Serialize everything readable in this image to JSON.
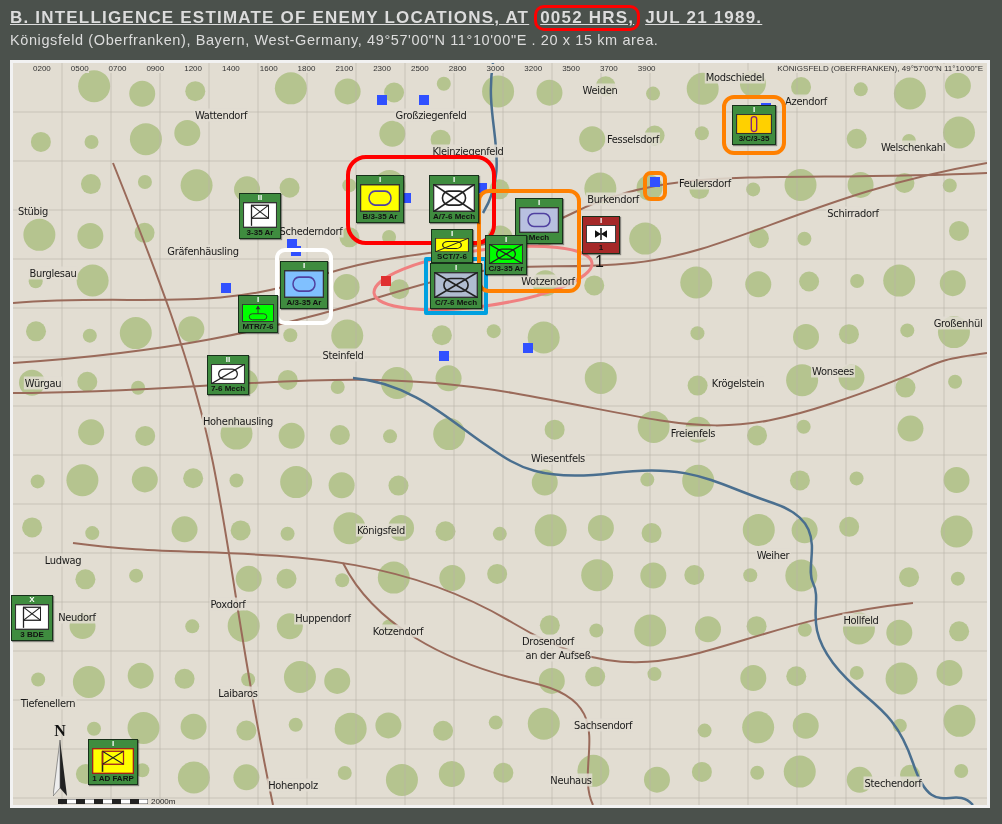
{
  "header": {
    "title_before": "B. INTELLIGENCE ESTIMATE OF ENEMY LOCATIONS, AT",
    "title_highlight": "0052 HRS,",
    "title_after": "JUL 21 1989.",
    "subtitle": "Königsfeld (Oberfranken), Bayern, West-Germany, 49°57'00\"N 11°10'00\"E . 20 x 15 km area."
  },
  "map": {
    "grid_labels": [
      "0200",
      "0500",
      "0700",
      "0900",
      "1200",
      "1400",
      "1600",
      "1800",
      "2100",
      "2300",
      "2500",
      "2800",
      "3000",
      "3200",
      "3500",
      "3700",
      "3900"
    ],
    "sheet_label": "KÖNIGSFELD (OBERFRANKEN), 49°57'00\"N 11°10'00\"E",
    "towns": [
      "Wattendorf",
      "Großziegenfeld",
      "Kleinziegenfeld",
      "Weiden",
      "Modschiedel",
      "Azendorf",
      "Welschenkahl",
      "Fesselsdorf",
      "Feulersdorf",
      "Burkendorf",
      "Stübig",
      "Schederndorf",
      "Gräfenhäusling",
      "Wotzendorf",
      "Schirradorf",
      "Burglesau",
      "Großenhül",
      "Würgau",
      "Steinfeld",
      "Krögelstein",
      "Wonsees",
      "Hohenhausling",
      "Freienfels",
      "Wiesentfels",
      "Ludwag",
      "Königsfeld",
      "Weiher",
      "Neudorf",
      "Poxdorf",
      "Huppendorf",
      "Kotzendorf",
      "Hollfeld",
      "Drosendorf",
      "an der Aufseß",
      "Tiefenellern",
      "Laibaros",
      "Sachsendorf",
      "Hohenpolz",
      "Neuhaus",
      "Stechendorf"
    ],
    "units": [
      {
        "label": "3-35 Ar",
        "echelon": "II",
        "hostile": false,
        "kind": "hq",
        "color": "#ffffff"
      },
      {
        "label": "B/3-35 Ar",
        "echelon": "I",
        "hostile": false,
        "kind": "armor",
        "color": "#ffff00"
      },
      {
        "label": "A/7-6 Mech",
        "echelon": "I",
        "hostile": false,
        "kind": "mech",
        "color": "#ffffff"
      },
      {
        "label": "A/3-35 Ar",
        "echelon": "I",
        "hostile": false,
        "kind": "armor",
        "color": "#80c0ff"
      },
      {
        "label": "MTR/7-6",
        "echelon": "I",
        "hostile": false,
        "kind": "mortar",
        "color": "#00ff00"
      },
      {
        "label": "7-6 Mech",
        "echelon": "II",
        "hostile": false,
        "kind": "recon",
        "color": "#ffffff"
      },
      {
        "label": "SCT/7-6",
        "echelon": "I",
        "hostile": false,
        "kind": "recon",
        "color": "#ffff00"
      },
      {
        "label": "C/7-6 Mech",
        "echelon": "I",
        "hostile": false,
        "kind": "mech",
        "color": "#b0bcd0"
      },
      {
        "label": "Mech",
        "echelon": "I",
        "hostile": false,
        "kind": "armor",
        "color": "#b8c0e0"
      },
      {
        "label": "C/3-35 Ar",
        "echelon": "I",
        "hostile": false,
        "kind": "mech",
        "color": "#00ff00"
      },
      {
        "label": "1",
        "echelon": "I",
        "hostile": true,
        "kind": "aviation",
        "color": "#ffffff"
      },
      {
        "label": "3/C/3-35",
        "echelon": "I",
        "hostile": false,
        "kind": "ammo",
        "color": "#ffd000"
      },
      {
        "label": "3 BDE",
        "echelon": "X",
        "hostile": false,
        "kind": "hq",
        "color": "#ffffff"
      },
      {
        "label": "1 AD FARP",
        "echelon": "I",
        "hostile": false,
        "kind": "supply",
        "color": "#ffff00"
      }
    ],
    "enemy_count": "1",
    "highlights": [
      {
        "color": "#ff0000"
      },
      {
        "color": "#ffffff"
      },
      {
        "color": "#00a0e0"
      },
      {
        "color": "#ff8000"
      },
      {
        "color": "#ff8000"
      },
      {
        "color": "#ff8000"
      }
    ],
    "compass": "N",
    "scale": "2000m"
  }
}
